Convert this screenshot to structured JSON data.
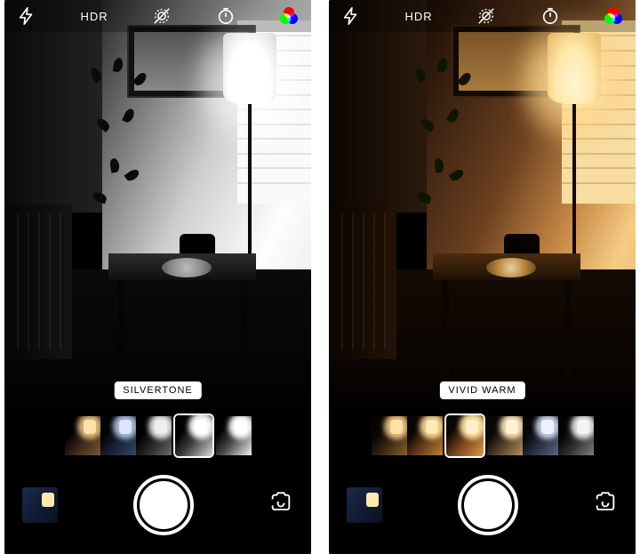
{
  "screens": [
    {
      "id": "left",
      "theme": "silvertone",
      "topbar": {
        "hdr_label": "HDR"
      },
      "filter_badge": "SILVERTONE",
      "thumbs": [
        {
          "bg": "linear-gradient(130deg,#000 30%,#362318 55%,#7a5632 100%)",
          "lamp": "#ffe2a8",
          "glow": "rgba(255,214,140,.8)",
          "sel": false
        },
        {
          "bg": "linear-gradient(130deg,#030308 30%,#1a2236 60%,#32486a 100%)",
          "lamp": "#dce4ff",
          "glow": "rgba(200,220,255,.8)",
          "sel": false
        },
        {
          "bg": "linear-gradient(130deg,#000 30%,#262626 60%,#6c6c6c 100%)",
          "lamp": "#eee",
          "glow": "rgba(255,255,255,.85)",
          "sel": false
        },
        {
          "bg": "linear-gradient(130deg,#000 28%,#3c3c3c 55%,#d9d9d9 100%)",
          "lamp": "#fff",
          "glow": "rgba(255,255,255,.95)",
          "sel": true
        },
        {
          "bg": "linear-gradient(130deg,#000 25%,#4a4a4a 55%,#f2f2f2 100%)",
          "lamp": "#fff",
          "glow": "rgba(255,255,255,.95)",
          "sel": false
        }
      ]
    },
    {
      "id": "right",
      "theme": "vividwarm",
      "topbar": {
        "hdr_label": "HDR"
      },
      "filter_badge": "VIVID WARM",
      "thumbs": [
        {
          "bg": "linear-gradient(130deg,#080502 30%,#3a2612 60%,#8a6230 100%)",
          "lamp": "#ffe2a8",
          "glow": "rgba(255,214,140,.85)",
          "sel": false
        },
        {
          "bg": "linear-gradient(130deg,#0a0502 28%,#5a3414 55%,#c08038 100%)",
          "lamp": "#ffe9b6",
          "glow": "rgba(255,220,150,.9)",
          "sel": false
        },
        {
          "bg": "linear-gradient(130deg,#0c0602 25%,#74421a 55%,#e09a46 100%)",
          "lamp": "#fff0c8",
          "glow": "rgba(255,230,160,.95)",
          "sel": true
        },
        {
          "bg": "linear-gradient(130deg,#0a0704 30%,#56402a 60%,#b49060 100%)",
          "lamp": "#fff2d6",
          "glow": "rgba(255,236,190,.9)",
          "sel": false
        },
        {
          "bg": "linear-gradient(130deg,#060608 30%,#2a3044 60%,#5a6684 100%)",
          "lamp": "#eef2ff",
          "glow": "rgba(220,230,255,.85)",
          "sel": false
        },
        {
          "bg": "linear-gradient(130deg,#040404 30%,#303030 60%,#808080 100%)",
          "lamp": "#f4f4f4",
          "glow": "rgba(255,255,255,.85)",
          "sel": false
        }
      ]
    }
  ]
}
